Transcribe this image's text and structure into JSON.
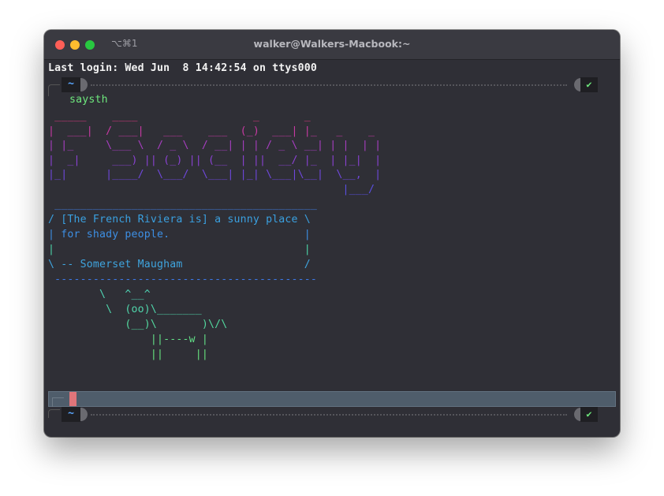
{
  "window": {
    "title": "walker@Walkers-Macbook:~",
    "shortcut": "⌥⌘1"
  },
  "terminal": {
    "last_login": "Last login: Wed Jun  8 14:42:54 on ttys000",
    "prompt_dir": "~",
    "prompt_status": "✔",
    "command": "saysth",
    "banner_art": [
      {
        "text": " _____    ____                  _       _             ",
        "color": "#d9397e"
      },
      {
        "text": "|  ___|  / ___|   ___    ___  (_)  ___| |_   _    _   ",
        "color": "#c83aa4"
      },
      {
        "text": "| |_     \\___ \\  / _ \\  / __| | | / _ \\ __| | |  | |  ",
        "color": "#a73ec0"
      },
      {
        "text": "|  _|     ___) || (_) || (__  | ||  __/ |_  | |_|  |  ",
        "color": "#8a42d2"
      },
      {
        "text": "|_|      |____/  \\___/  \\___| |_| \\___|\\__|  \\__,  |  ",
        "color": "#6f48dc"
      },
      {
        "text": "                                              |___/   ",
        "color": "#5a4fe2"
      }
    ],
    "cowsay_lines": [
      {
        "text": " _________________________________________",
        "color": "#3f7fe6"
      },
      {
        "text": "/ [The French Riviera is] a sunny place \\",
        "color": "#3aa0e0"
      },
      {
        "text": "| for shady people.                     |",
        "color": "#3d8fe4"
      },
      {
        "text": "|                                       |",
        "color": "#4bd3a7"
      },
      {
        "text": "\\ -- Somerset Maugham                   /",
        "color": "#3fa5df"
      },
      {
        "text": " -----------------------------------------",
        "color": "#3d79e6"
      },
      {
        "text": "        \\   ^__^",
        "color": "#4fd4b4"
      },
      {
        "text": "         \\  (oo)\\_______",
        "color": "#50d5ab"
      },
      {
        "text": "            (__)\\       )\\/\\",
        "color": "#53d89e"
      },
      {
        "text": "                ||----w |",
        "color": "#62df87"
      },
      {
        "text": "                ||     ||",
        "color": "#66e17d"
      }
    ]
  }
}
